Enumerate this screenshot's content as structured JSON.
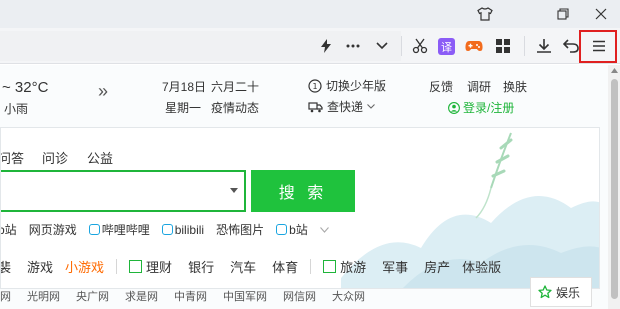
{
  "titlebar": {
    "skin_icon": "shirt-icon",
    "restore_icon": "restore-icon",
    "close_icon": "close-icon"
  },
  "toolbar": {
    "icons": [
      "lightning-icon",
      "more-icon",
      "chevron-down-icon",
      "scissors-icon",
      "translate-icon",
      "gamepad-icon",
      "apps-grid-icon",
      "download-icon",
      "undo-icon",
      "menu-icon"
    ],
    "translate_label": "译"
  },
  "weather": {
    "temp": "~ 32°C",
    "desc": "小雨",
    "expand": "»"
  },
  "date": {
    "day": "7月18日",
    "lunar": "六月二十",
    "weekday": "星期一",
    "news": "疫情动态"
  },
  "top_links": {
    "youth_mode": "切换少年版",
    "express": "查快递",
    "feedback": "反馈",
    "survey": "调研",
    "skin": "换肤",
    "login": "登录/注册"
  },
  "tabs": [
    "问答",
    "问诊",
    "公益"
  ],
  "search": {
    "button": "搜 索",
    "value": ""
  },
  "hot_links": [
    "b站",
    "网页游戏",
    "哔哩哔哩",
    "bilibili",
    "恐怖图片",
    "b站"
  ],
  "nav_row": {
    "group1": [
      "裴",
      "游戏",
      "小游戏"
    ],
    "group2": [
      "理财",
      "银行",
      "汽车",
      "体育"
    ],
    "group3": [
      "旅游",
      "军事",
      "房产",
      "体验版"
    ]
  },
  "sites": [
    "网",
    "光明网",
    "央广网",
    "求是网",
    "中青网",
    "中国军网",
    "网信网",
    "大众网"
  ],
  "entertainment": "娱乐",
  "colors": {
    "accent_green": "#1fc23d",
    "highlight_red": "#e02020"
  }
}
